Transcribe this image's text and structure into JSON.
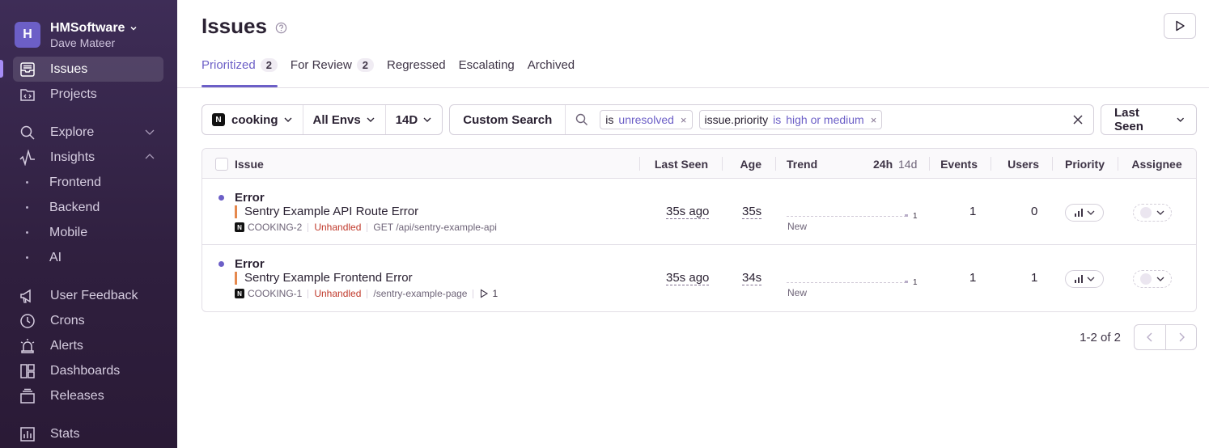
{
  "org": {
    "initial": "H",
    "name": "HMSoftware",
    "user": "Dave Mateer"
  },
  "sidebar": {
    "items": [
      {
        "label": "Issues",
        "icon": "issues-icon"
      },
      {
        "label": "Projects",
        "icon": "projects-icon"
      },
      {
        "label": "Explore",
        "icon": "search-icon"
      },
      {
        "label": "Insights",
        "icon": "insights-icon"
      },
      {
        "label": "User Feedback",
        "icon": "megaphone-icon"
      },
      {
        "label": "Crons",
        "icon": "clock-icon"
      },
      {
        "label": "Alerts",
        "icon": "siren-icon"
      },
      {
        "label": "Dashboards",
        "icon": "dashboard-icon"
      },
      {
        "label": "Releases",
        "icon": "releases-icon"
      },
      {
        "label": "Stats",
        "icon": "stats-icon"
      }
    ],
    "insights_sub": [
      "Frontend",
      "Backend",
      "Mobile",
      "AI"
    ]
  },
  "page": {
    "title": "Issues"
  },
  "tabs": [
    {
      "label": "Prioritized",
      "count": "2"
    },
    {
      "label": "For Review",
      "count": "2"
    },
    {
      "label": "Regressed"
    },
    {
      "label": "Escalating"
    },
    {
      "label": "Archived"
    }
  ],
  "filters": {
    "project": "cooking",
    "env": "All Envs",
    "period": "14D",
    "custom_search": "Custom Search",
    "sort": "Last Seen"
  },
  "search_tokens": [
    {
      "key": "is",
      "op": "",
      "value": "unresolved"
    },
    {
      "key": "issue.priority",
      "op": "is",
      "value": "high or medium"
    }
  ],
  "table": {
    "headers": {
      "issue": "Issue",
      "last_seen": "Last Seen",
      "age": "Age",
      "trend": "Trend",
      "t24": "24h",
      "t14": "14d",
      "events": "Events",
      "users": "Users",
      "priority": "Priority",
      "assignee": "Assignee"
    },
    "rows": [
      {
        "type": "Error",
        "message": "Sentry Example API Route Error",
        "short_id": "COOKING-2",
        "handled": "Unhandled",
        "culprit": "GET /api/sentry-example-api",
        "replays": "",
        "last_seen": "35s ago",
        "age": "35s",
        "trend_max": "1",
        "trend_label": "New",
        "events": "1",
        "users": "0"
      },
      {
        "type": "Error",
        "message": "Sentry Example Frontend Error",
        "short_id": "COOKING-1",
        "handled": "Unhandled",
        "culprit": "/sentry-example-page",
        "replays": "1",
        "last_seen": "35s ago",
        "age": "34s",
        "trend_max": "1",
        "trend_label": "New",
        "events": "1",
        "users": "1"
      }
    ]
  },
  "pagination": {
    "text": "1-2 of 2"
  },
  "colors": {
    "accent": "#6c5fc7",
    "sidebar": "#3e2d57",
    "unhandled": "#c0392b",
    "level_bar": "#e5884d"
  }
}
